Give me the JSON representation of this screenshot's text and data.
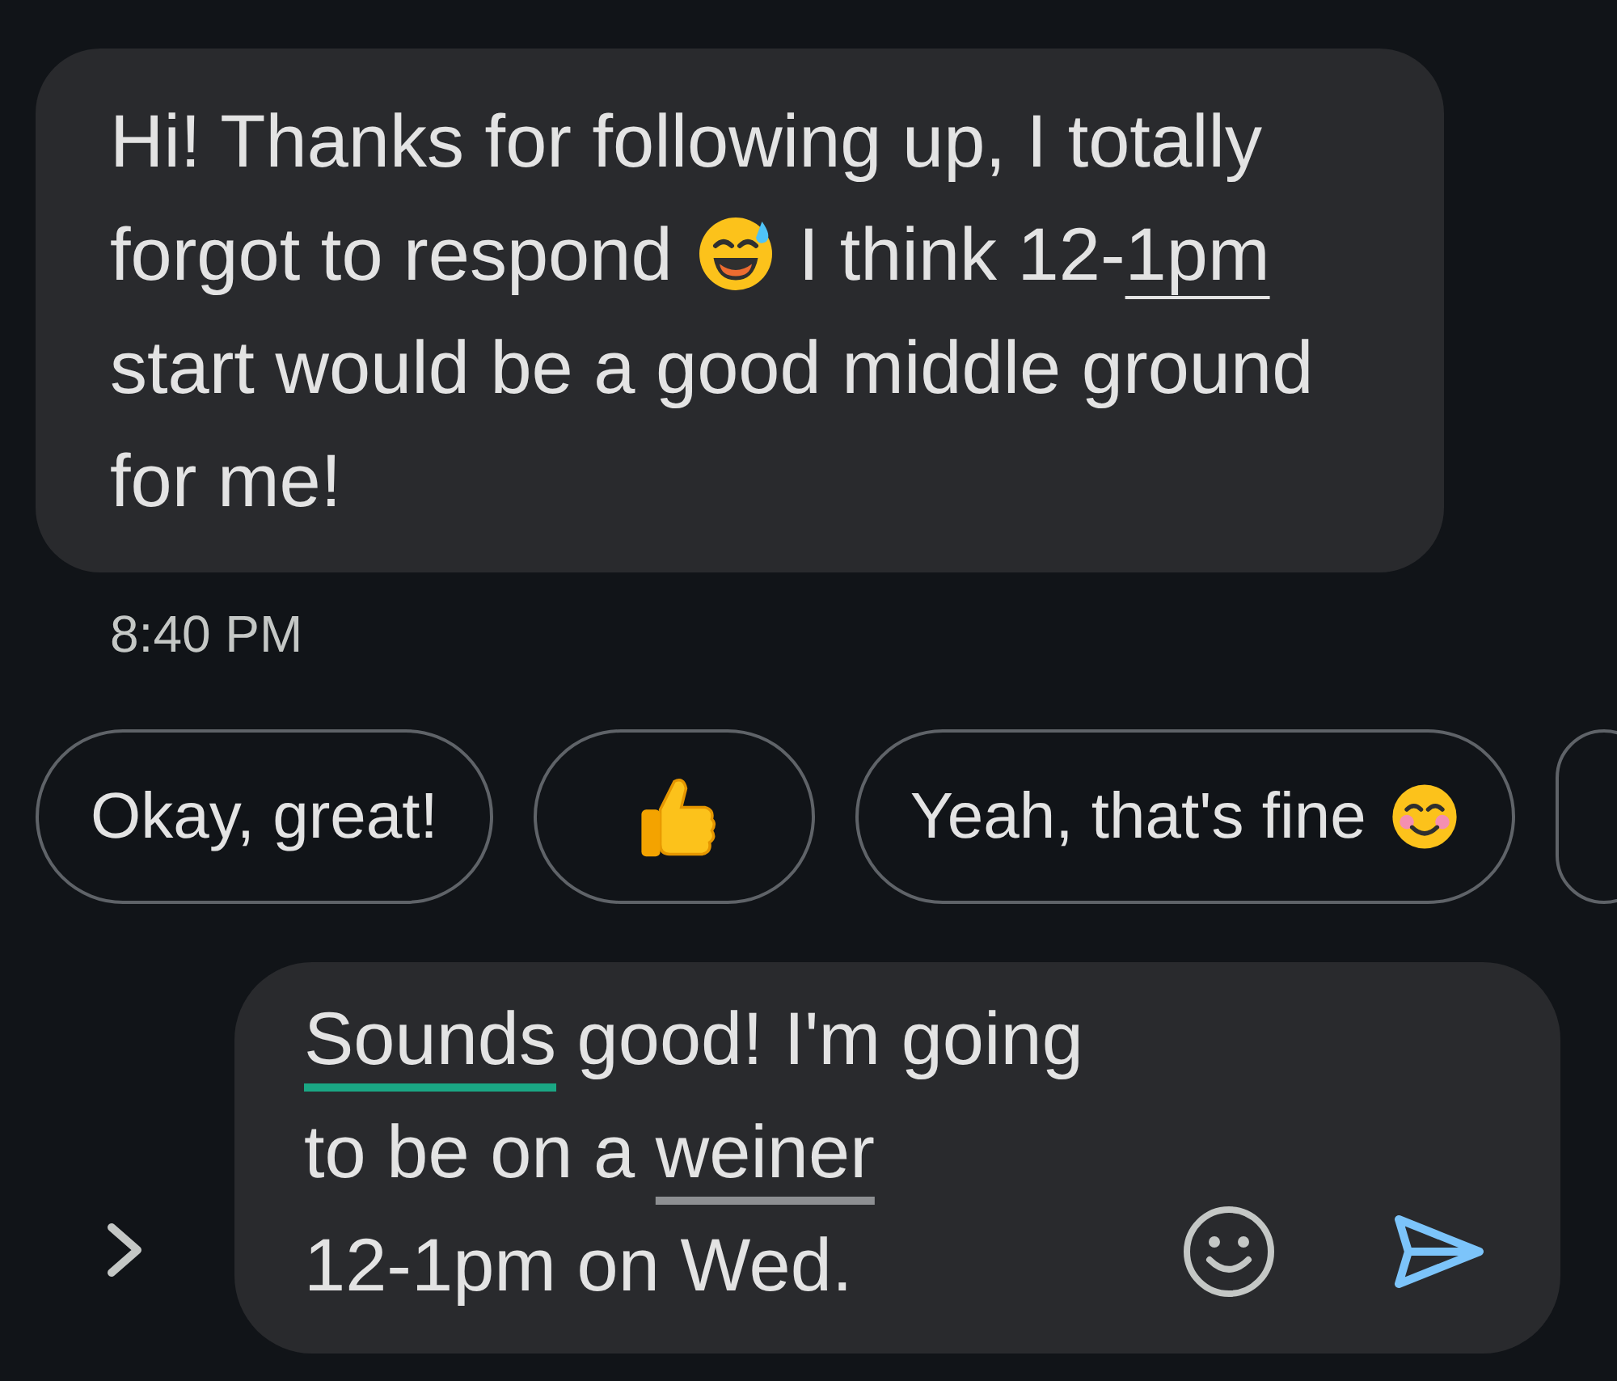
{
  "received_message": {
    "lines": [
      [
        {
          "kind": "text",
          "text": "Hi! Thanks for following up, I totally"
        }
      ],
      [
        {
          "kind": "text",
          "text": "forgot to respond"
        },
        {
          "kind": "emoji-sweat-smile"
        },
        {
          "kind": "text",
          "text": "I think 12-"
        },
        {
          "kind": "link",
          "text": "1pm"
        }
      ],
      [
        {
          "kind": "text",
          "text": "start would be a good middle ground"
        }
      ],
      [
        {
          "kind": "text",
          "text": "for me!"
        }
      ]
    ],
    "time": "8:40 PM"
  },
  "suggestions": [
    {
      "kind": "text",
      "label": "Okay, great!"
    },
    {
      "kind": "emoji-thumbs-up"
    },
    {
      "kind": "text-with-smile",
      "label": "Yeah, that's fine"
    },
    {
      "kind": "cut"
    }
  ],
  "composer": {
    "lines": [
      [
        {
          "kind": "suggestion",
          "text": "Sounds"
        },
        {
          "kind": "plain",
          "text": " good! I'm going"
        }
      ],
      [
        {
          "kind": "plain",
          "text": "to be on a "
        },
        {
          "kind": "misspelled",
          "text": "weiner"
        }
      ],
      [
        {
          "kind": "plain",
          "text": "12-1pm on Wed."
        }
      ]
    ]
  }
}
